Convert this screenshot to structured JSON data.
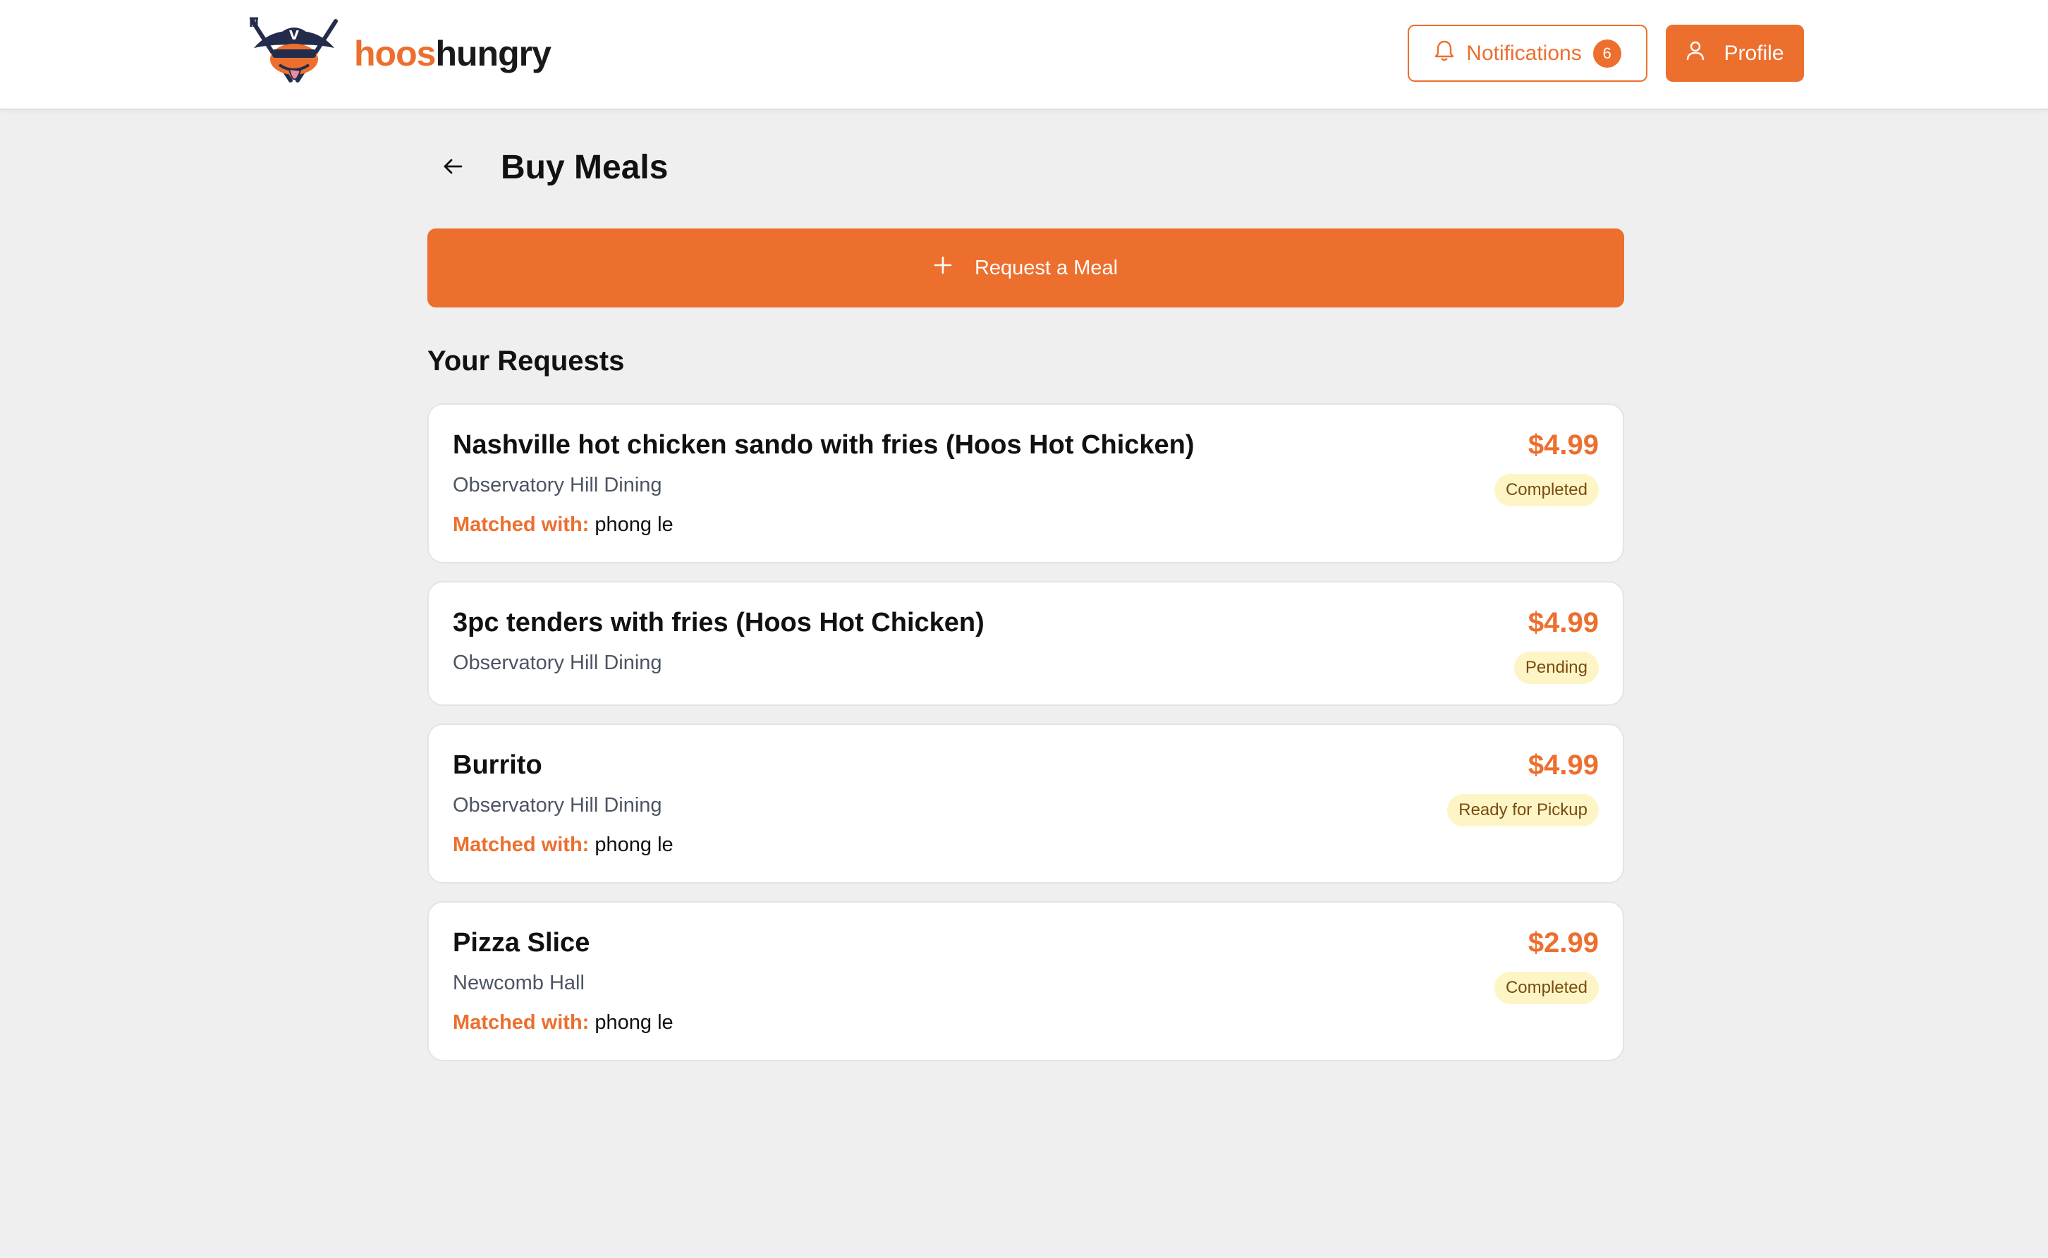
{
  "brand": {
    "part1": "hoos",
    "part2": "hungry"
  },
  "header": {
    "notifications_label": "Notifications",
    "notifications_count": "6",
    "profile_label": "Profile"
  },
  "page": {
    "title": "Buy Meals",
    "request_button": "Request a Meal",
    "section_title": "Your Requests"
  },
  "requests": [
    {
      "name": "Nashville hot chicken sando with fries (Hoos Hot Chicken)",
      "venue": "Observatory Hill Dining",
      "matched_label": "Matched with:",
      "matched_value": "phong le",
      "price": "$4.99",
      "status": "Completed"
    },
    {
      "name": "3pc tenders with fries (Hoos Hot Chicken)",
      "venue": "Observatory Hill Dining",
      "price": "$4.99",
      "status": "Pending"
    },
    {
      "name": "Burrito",
      "venue": "Observatory Hill Dining",
      "matched_label": "Matched with:",
      "matched_value": "phong le",
      "price": "$4.99",
      "status": "Ready for Pickup"
    },
    {
      "name": "Pizza Slice",
      "venue": "Newcomb Hall",
      "matched_label": "Matched with:",
      "matched_value": "phong le",
      "price": "$2.99",
      "status": "Completed"
    }
  ],
  "colors": {
    "accent": "#ec6f2e",
    "status_bg": "#fdf5c5",
    "page_bg": "#efefef"
  },
  "icons": {
    "logo": "cavalier-mascot-logo",
    "notifications": "bell-icon",
    "profile": "user-icon",
    "back": "arrow-left-icon",
    "request": "plus-icon"
  }
}
